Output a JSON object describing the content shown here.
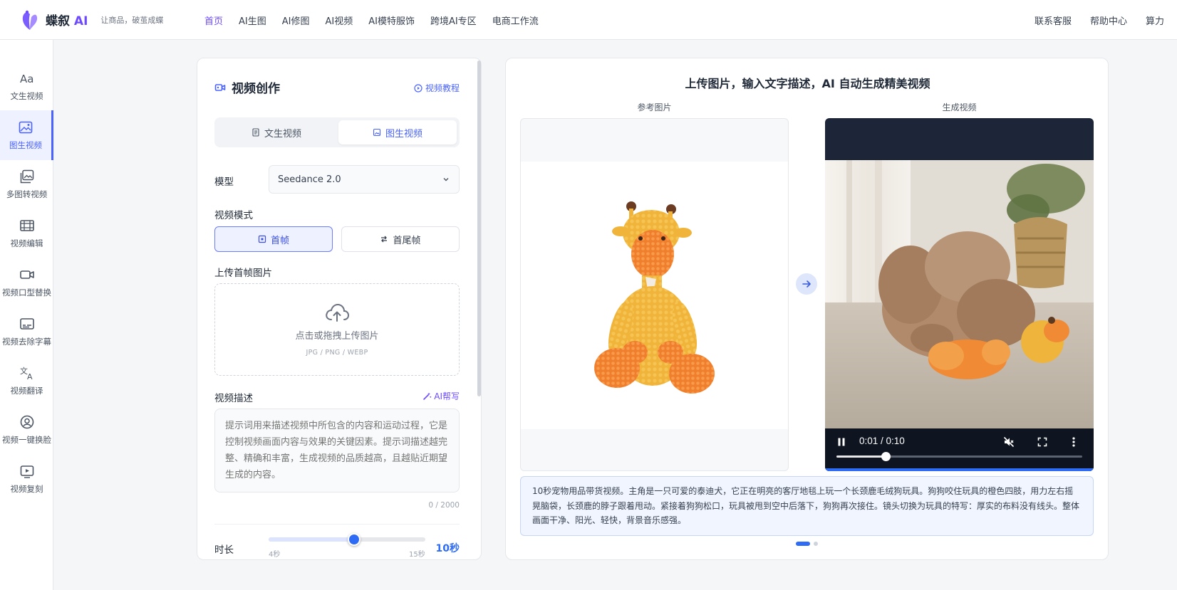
{
  "brand": {
    "name": "蝶叙",
    "name_ai": "AI",
    "slogan": "让商品，破茧成蝶"
  },
  "nav": {
    "items": [
      "首页",
      "AI生图",
      "AI修图",
      "AI视频",
      "AI模特服饰",
      "跨境AI专区",
      "电商工作流"
    ],
    "active": "首页",
    "right": [
      "联系客服",
      "帮助中心",
      "算力"
    ]
  },
  "sidebar": {
    "items": [
      {
        "label": "文生视频",
        "icon": "text-aa-icon"
      },
      {
        "label": "图生视频",
        "icon": "image-icon",
        "active": true
      },
      {
        "label": "多图转视频",
        "icon": "multi-image-icon"
      },
      {
        "label": "视频编辑",
        "icon": "film-icon"
      },
      {
        "label": "视频口型替换",
        "icon": "video-camera-icon"
      },
      {
        "label": "视频去除字幕",
        "icon": "subtitle-icon"
      },
      {
        "label": "视频翻译",
        "icon": "translate-icon"
      },
      {
        "label": "视频一键换脸",
        "icon": "face-swap-icon"
      },
      {
        "label": "视频复刻",
        "icon": "video-play-icon"
      }
    ]
  },
  "panel": {
    "title": "视频创作",
    "tutorial": "视频教程",
    "tabs": [
      {
        "label": "文生视频",
        "active": false
      },
      {
        "label": "图生视频",
        "active": true
      }
    ],
    "model_label": "模型",
    "model_value": "Seedance 2.0",
    "mode_label": "视频模式",
    "modes": [
      {
        "label": "首帧",
        "active": true
      },
      {
        "label": "首尾帧",
        "active": false
      }
    ],
    "upload_label": "上传首帧图片",
    "upload_text": "点击或拖拽上传图片",
    "upload_hint": "JPG / PNG / WEBP",
    "desc_label": "视频描述",
    "ai_write": "AI帮写",
    "desc_placeholder": "提示词用来描述视频中所包含的内容和运动过程，它是控制视频画面内容与效果的关键因素。提示词描述越完整、精确和丰富，生成视频的品质越高，且越贴近期望生成的内容。",
    "desc_value": "",
    "counter": "0 / 2000",
    "duration_label": "时长",
    "duration_min": "4秒",
    "duration_max": "15秒",
    "duration_value": "10秒",
    "duration_seconds": 10,
    "duration_range": [
      4,
      15
    ]
  },
  "showcase": {
    "title": "上传图片，输入文字描述，AI 自动生成精美视频",
    "ref_label": "参考图片",
    "gen_label": "生成视频",
    "video_time": "0:01 / 0:10",
    "progress_fraction": 0.2,
    "description": "10秒宠物用品带货视频。主角是一只可爱的泰迪犬，它正在明亮的客厅地毯上玩一个长颈鹿毛绒狗玩具。狗狗咬住玩具的橙色四肢，用力左右摇晃脑袋，长颈鹿的脖子跟着甩动。紧接着狗狗松口，玩具被甩到空中后落下，狗狗再次接住。镜头切换为玩具的特写：厚实的布料没有线头。整体画面干净、阳光、轻快，背景音乐感强。",
    "slides": 2,
    "active_slide": 0
  },
  "colors": {
    "accent": "#4a63ff",
    "brand": "#6d4aff",
    "slider": "#2f6cf5"
  }
}
